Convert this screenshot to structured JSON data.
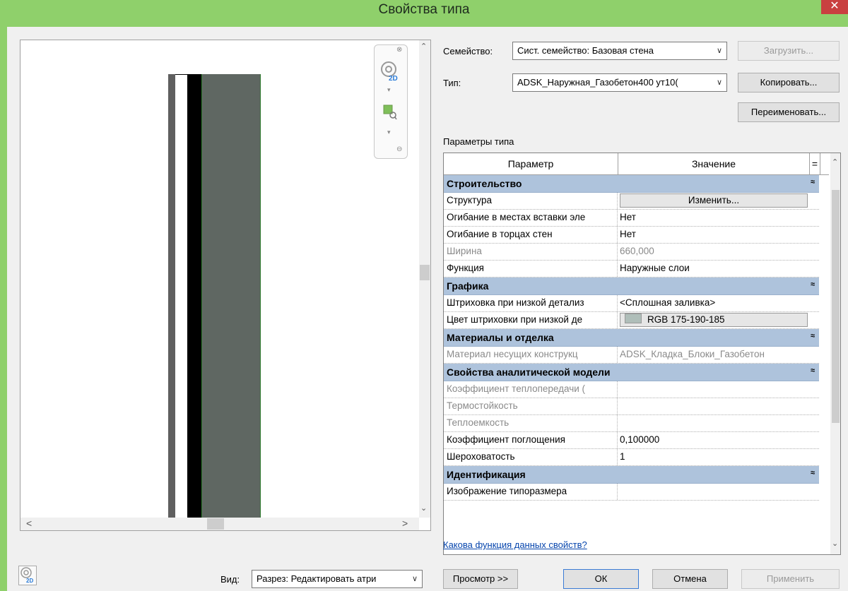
{
  "window": {
    "title": "Свойства типа",
    "close": "✕"
  },
  "preview": {
    "wall_layers": [
      {
        "name": "outer-finish-layer",
        "color": "#5f5f5f"
      },
      {
        "name": "air-gap-layer",
        "color": "#ffffff"
      },
      {
        "name": "insulation-layer",
        "color": "#000000"
      },
      {
        "name": "core-layer",
        "color": "#5f6762"
      }
    ],
    "view_label": "Вид:",
    "view_value": "Разрез: Редактировать атри"
  },
  "family": {
    "label": "Семейство:",
    "value": "Сист. семейство: Базовая стена",
    "load_button": "Загрузить..."
  },
  "type": {
    "label": "Тип:",
    "value": "ADSK_Наружная_Газобетон400 ут10(",
    "copy_button": "Копировать...",
    "rename_button": "Переименовать..."
  },
  "params_title": "Параметры типа",
  "grid": {
    "col_param": "Параметр",
    "col_value": "Значение",
    "col_eq": "=",
    "groups": [
      {
        "title": "Строительство",
        "rows": [
          {
            "k": "Структура",
            "v": "Изменить...",
            "button": true
          },
          {
            "k": "Огибание в местах вставки эле",
            "v": "Нет"
          },
          {
            "k": "Огибание в торцах стен",
            "v": "Нет"
          },
          {
            "k": "Ширина",
            "v": "660,000",
            "grey": true
          },
          {
            "k": "Функция",
            "v": "Наружные слои"
          }
        ]
      },
      {
        "title": "Графика",
        "rows": [
          {
            "k": "Штриховка при низкой детализ",
            "v": "<Сплошная заливка>"
          },
          {
            "k": "Цвет штриховки при низкой де",
            "v": "RGB 175-190-185",
            "button": true,
            "swatch": true
          }
        ]
      },
      {
        "title": "Материалы и отделка",
        "rows": [
          {
            "k": "Материал несущих конструкц",
            "v": "ADSK_Кладка_Блоки_Газобетон",
            "grey": true
          }
        ]
      },
      {
        "title": "Свойства аналитической модели",
        "rows": [
          {
            "k": "Коэффициент теплопередачи (",
            "v": "",
            "grey": true
          },
          {
            "k": "Термостойкость",
            "v": "",
            "grey": true
          },
          {
            "k": "Теплоемкость",
            "v": "",
            "grey": true
          },
          {
            "k": "Коэффициент поглощения",
            "v": "0,100000"
          },
          {
            "k": "Шероховатость",
            "v": "1"
          }
        ]
      },
      {
        "title": "Идентификация",
        "rows": [
          {
            "k": "Изображение типоразмера",
            "v": ""
          }
        ]
      }
    ],
    "toggle_glyph": "≈"
  },
  "help_link": "Какова функция данных свойств?",
  "buttons": {
    "preview": "Просмотр >>",
    "ok": "ОК",
    "cancel": "Отмена",
    "apply": "Применить"
  },
  "icons": {
    "nav_wheel": "navigation-wheel-2d-icon",
    "zoom": "zoom-region-icon",
    "scroll_up": "▲",
    "scroll_down": "▼",
    "scroll_left": "<",
    "scroll_right": ">"
  }
}
